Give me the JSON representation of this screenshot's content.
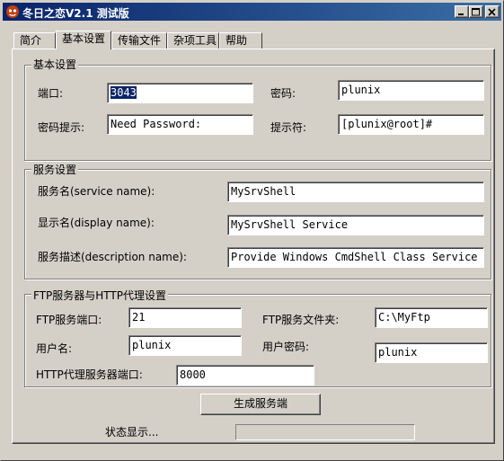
{
  "window": {
    "title": "冬日之恋V2.1  测试版",
    "controls": {
      "minimize": "minimize-icon",
      "maximize": "maximize-icon",
      "close": "close-icon"
    }
  },
  "tabs": [
    {
      "label": "简介"
    },
    {
      "label": "基本设置"
    },
    {
      "label": "传输文件"
    },
    {
      "label": "杂项工具"
    },
    {
      "label": "帮助"
    }
  ],
  "active_tab": "基本设置",
  "basic": {
    "legend": "基本设置",
    "port_label": "端口:",
    "port_value": "3043",
    "password_label": "密码:",
    "password_value": "plunix",
    "hint_label": "密码提示:",
    "hint_value": "Need Password:",
    "prompt_label": "提示符:",
    "prompt_value": "[plunix@root]#"
  },
  "service": {
    "legend": "服务设置",
    "name_label": "服务名(service name):",
    "name_value": "MySrvShell",
    "display_label": "显示名(display name):",
    "display_value": "MySrvShell Service",
    "desc_label": "服务描述(description name):",
    "desc_value": "Provide Windows CmdShell Class Service"
  },
  "ftp": {
    "legend": "FTP服务器与HTTP代理设置",
    "port_label": "FTP服务端口:",
    "port_value": "21",
    "folder_label": "FTP服务文件夹:",
    "folder_value": "C:\\MyFtp",
    "user_label": "用户名:",
    "user_value": "plunix",
    "pass_label": "用户密码:",
    "pass_value": "plunix",
    "http_label": "HTTP代理服务器端口:",
    "http_value": "8000"
  },
  "actions": {
    "generate": "生成服务端"
  },
  "status": {
    "label": "状态显示..."
  }
}
